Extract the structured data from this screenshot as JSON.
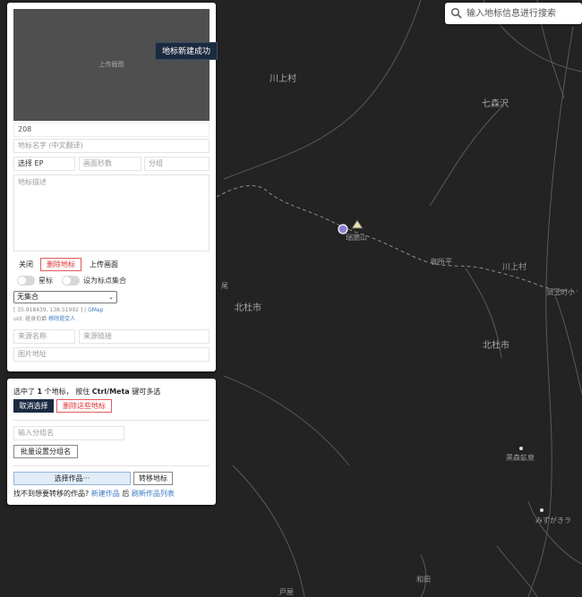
{
  "map": {
    "labels": [
      "川上村",
      "七森沢",
      "北杜市",
      "北杜市",
      "瑞牆山",
      "川上村",
      "御所平",
      "須玉町小",
      "尾",
      "黒森鉱泉",
      "みずがきラ",
      "和田",
      "戸屋"
    ],
    "peak_label": "瑞牆山",
    "colors": {
      "background": "#232323",
      "road": "#6a6a6a",
      "trail": "#8a8a8a",
      "marker": "#8b7fd0"
    }
  },
  "search": {
    "placeholder": "输入地标信息进行搜索",
    "icon": "search-icon"
  },
  "editor": {
    "screenshot_label": "上传截图",
    "toast": "地标新建成功",
    "id_value": "208",
    "name_placeholder": "地标名字 (中文翻译)",
    "ep_placeholder": "选择 EP",
    "seconds_placeholder": "画面秒数",
    "group_placeholder": "分组",
    "desc_placeholder": "地标描述",
    "close_label": "关闭",
    "delete_label": "删除地标",
    "upload_label": "上传画面",
    "star_label": "星标",
    "collection_label": "设为标点集合",
    "collection_value": "无集合",
    "coords": "[ 35.918439, 138.51992 ]",
    "gmap_label": "GMap",
    "uid_text": "uid: 赃食伯爵",
    "remove_submitter": "移除提交人",
    "source_name_placeholder": "来源名称",
    "source_link_placeholder": "来源链接",
    "image_url_placeholder": "图片地址"
  },
  "batch": {
    "selected_prefix": "选中了",
    "selected_count": "1",
    "selected_suffix": "个地标，  按住",
    "key_hint": "Ctrl/Meta",
    "selected_tail": "键可多选",
    "cancel_label": "取消选择",
    "delete_selected_label": "删除这些地标",
    "group_placeholder": "输入分组名",
    "set_group_label": "批量设置分组名",
    "choose_work_label": "选择作品···",
    "move_label": "转移地标",
    "not_found_text": "找不到想要转移的作品?",
    "new_work_link": "新建作品",
    "then_text": "后",
    "refresh_link": "刷新作品列表"
  }
}
